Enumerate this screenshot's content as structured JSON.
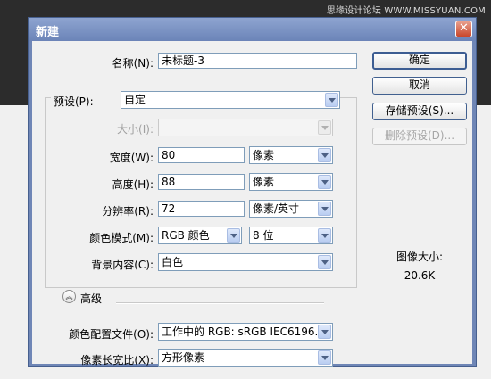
{
  "watermark": "思缘设计论坛 WWW.MISSYUAN.COM",
  "window": {
    "title": "新建",
    "close_glyph": "✕"
  },
  "form": {
    "name_label": "名称(N):",
    "name_value": "未标题-3",
    "preset_label": "预设(P):",
    "preset_value": "自定",
    "size_label": "大小(I):",
    "size_value": "",
    "width_label": "宽度(W):",
    "width_value": "80",
    "width_unit": "像素",
    "height_label": "高度(H):",
    "height_value": "88",
    "height_unit": "像素",
    "resolution_label": "分辨率(R):",
    "resolution_value": "72",
    "resolution_unit": "像素/英寸",
    "color_mode_label": "颜色模式(M):",
    "color_mode_value": "RGB 颜色",
    "bit_depth_value": "8 位",
    "background_label": "背景内容(C):",
    "background_value": "白色",
    "advanced_label": "高级",
    "advanced_glyph": "︽",
    "color_profile_label": "颜色配置文件(O):",
    "color_profile_value": "工作中的 RGB: sRGB IEC6196...",
    "pixel_aspect_label": "像素长宽比(X):",
    "pixel_aspect_value": "方形像素"
  },
  "buttons": {
    "ok": "确定",
    "cancel": "取消",
    "save_preset": "存储预设(S)...",
    "delete_preset": "删除预设(D)..."
  },
  "image_size": {
    "label": "图像大小:",
    "value": "20.6K"
  },
  "colors": {
    "title_bar": "#7a91c3",
    "background_dark": "#2c2c2c",
    "dialog_face": "#f0f0f0"
  }
}
